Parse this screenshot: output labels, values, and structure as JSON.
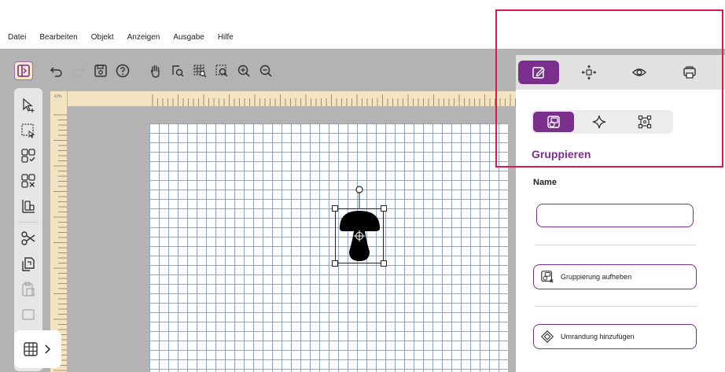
{
  "menu": {
    "items": [
      "Datei",
      "Bearbeiten",
      "Objekt",
      "Anzeigen",
      "Ausgabe",
      "Hilfe"
    ]
  },
  "toolbar": {
    "icons": [
      "panel-toggle-icon",
      "undo-icon",
      "redo-icon",
      "save-icon",
      "help-icon",
      "hand-icon",
      "zoom-page-icon",
      "zoom-grid-icon",
      "zoom-selection-icon",
      "zoom-in-icon",
      "zoom-out-icon"
    ]
  },
  "ruler": {
    "unit": "cm"
  },
  "right_panel": {
    "tabs": [
      "edit-icon",
      "move-icon",
      "view-icon",
      "output-icon"
    ],
    "subtabs": [
      "group-icon",
      "sparkle-icon",
      "frame-icon"
    ],
    "title": "Gruppieren",
    "name_label": "Name",
    "name_value": "",
    "ungroup_label": "Gruppierung aufheben",
    "add_outline_label": "Umrandung hinzufügen"
  },
  "colors": {
    "accent": "#7a2f8c",
    "highlight": "#d81b4a",
    "grid": "#8fa6c8",
    "ruler": "#f3e3c0"
  }
}
